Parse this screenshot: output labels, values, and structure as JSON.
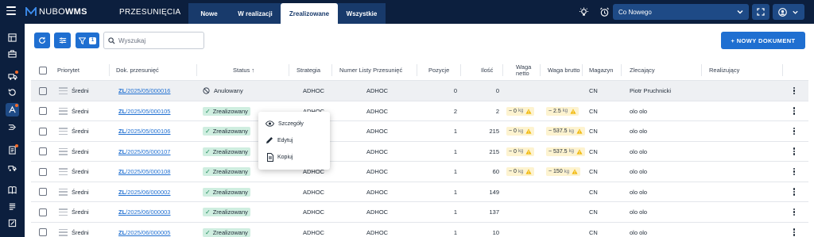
{
  "topbar": {
    "logo_prefix": "NUBO",
    "logo_suffix": "WMS",
    "module_title": "PRZESUNIĘCIA",
    "tabs": [
      {
        "label": "Nowe"
      },
      {
        "label": "W realizacji"
      },
      {
        "label": "Zrealizowane"
      },
      {
        "label": "Wszystkie"
      }
    ],
    "active_tab": "Zrealizowane",
    "warehouse": "Co Nowego"
  },
  "toolbar": {
    "filter_count": "1",
    "search_placeholder": "Wyszukaj",
    "new_document_label": "+ NOWY DOKUMENT"
  },
  "columns": {
    "priority": "Priorytet",
    "doc": "Dok. przesunięć",
    "status": "Status ↑",
    "strategy": "Strategia",
    "list_number": "Numer Listy Przesunięć",
    "positions": "Pozycje",
    "quantity": "Ilość",
    "net_weight_1": "Waga",
    "net_weight_2": "netto",
    "gross_weight": "Waga brutto",
    "warehouse": "Magazyn",
    "ordering": "Zlecający",
    "executing": "Realizujący"
  },
  "rows": [
    {
      "priority": "Średni",
      "doc_prefix": "ZL",
      "doc_rest": "/2025/05/000016",
      "status": "Anulowany",
      "status_type": "cancelled",
      "strategy": "ADHOC",
      "list_number": "ADHOC",
      "positions": "0",
      "quantity": "0",
      "net_weight": "",
      "gross_weight": "",
      "warehouse": "CN",
      "ordering": "Piotr Pruchnicki",
      "executing": ""
    },
    {
      "priority": "Średni",
      "doc_prefix": "ZL",
      "doc_rest": "/2025/05/000105",
      "status": "Zrealizowany",
      "status_type": "done",
      "strategy": "ADHOC",
      "list_number": "ADHOC",
      "positions": "2",
      "quantity": "2",
      "net_weight": "~ 0",
      "gross_weight": "~ 2.5",
      "warehouse": "CN",
      "ordering": "olo olo",
      "executing": ""
    },
    {
      "priority": "Średni",
      "doc_prefix": "ZL",
      "doc_rest": "/2025/05/000106",
      "status": "Zrealizowany",
      "status_type": "done",
      "strategy": "ADHOC",
      "list_number": "ADHOC",
      "positions": "1",
      "quantity": "215",
      "net_weight": "~ 0",
      "gross_weight": "~ 537.5",
      "warehouse": "CN",
      "ordering": "olo olo",
      "executing": ""
    },
    {
      "priority": "Średni",
      "doc_prefix": "ZL",
      "doc_rest": "/2025/05/000107",
      "status": "Zrealizowany",
      "status_type": "done",
      "strategy": "ADHOC",
      "list_number": "ADHOC",
      "positions": "1",
      "quantity": "215",
      "net_weight": "~ 0",
      "gross_weight": "~ 537.5",
      "warehouse": "CN",
      "ordering": "olo olo",
      "executing": ""
    },
    {
      "priority": "Średni",
      "doc_prefix": "ZL",
      "doc_rest": "/2025/05/000108",
      "status": "Zrealizowany",
      "status_type": "done",
      "strategy": "ADHOC",
      "list_number": "ADHOC",
      "positions": "1",
      "quantity": "60",
      "net_weight": "~ 0",
      "gross_weight": "~ 150",
      "warehouse": "CN",
      "ordering": "olo olo",
      "executing": ""
    },
    {
      "priority": "Średni",
      "doc_prefix": "ZL",
      "doc_rest": "/2025/06/000002",
      "status": "Zrealizowany",
      "status_type": "done",
      "strategy": "ADHOC",
      "list_number": "ADHOC",
      "positions": "1",
      "quantity": "149",
      "net_weight": "",
      "gross_weight": "",
      "warehouse": "CN",
      "ordering": "olo olo",
      "executing": ""
    },
    {
      "priority": "Średni",
      "doc_prefix": "ZL",
      "doc_rest": "/2025/06/000003",
      "status": "Zrealizowany",
      "status_type": "done",
      "strategy": "ADHOC",
      "list_number": "ADHOC",
      "positions": "1",
      "quantity": "137",
      "net_weight": "",
      "gross_weight": "",
      "warehouse": "CN",
      "ordering": "olo olo",
      "executing": ""
    },
    {
      "priority": "Średni",
      "doc_prefix": "ZL",
      "doc_rest": "/2025/06/000005",
      "status": "Zrealizowany",
      "status_type": "done",
      "strategy": "ADHOC",
      "list_number": "ADHOC",
      "positions": "1",
      "quantity": "10",
      "net_weight": "",
      "gross_weight": "",
      "warehouse": "CN",
      "ordering": "olo olo",
      "executing": ""
    }
  ],
  "weight_unit": "kg",
  "context_menu": {
    "details": "Szczegóły",
    "edit": "Edytuj",
    "copy": "Kopiuj"
  },
  "colors": {
    "topbar": "#0c1f3e",
    "accent": "#1f6fd1",
    "done_badge": "#cfeee0",
    "warning_badge": "#fdf3d0",
    "warning_icon": "#f2b705"
  }
}
